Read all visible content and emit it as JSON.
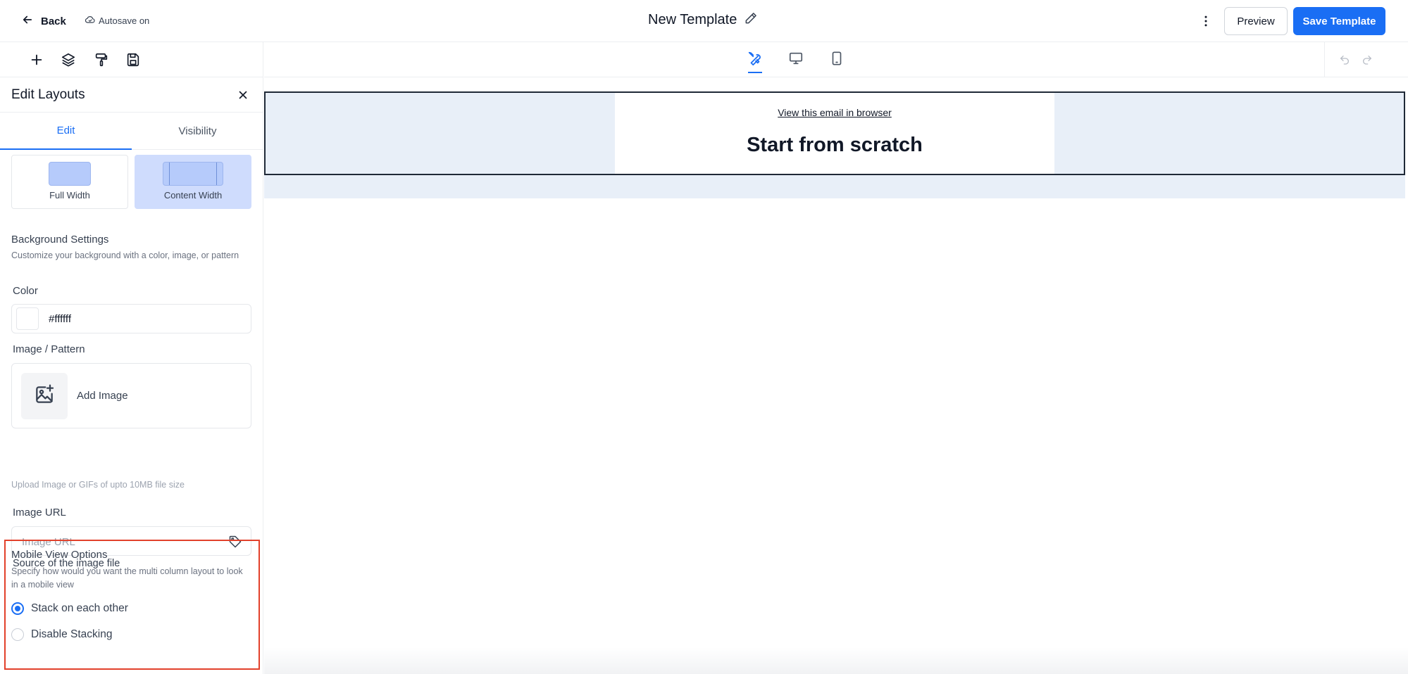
{
  "header": {
    "back_label": "Back",
    "autosave_label": "Autosave on",
    "title": "New Template",
    "preview_label": "Preview",
    "save_label": "Save Template"
  },
  "sidebar": {
    "panel_title": "Edit Layouts",
    "tabs": [
      {
        "label": "Edit",
        "active": true
      },
      {
        "label": "Visibility",
        "active": false
      }
    ],
    "width_options": [
      {
        "label": "Full Width",
        "selected": false
      },
      {
        "label": "Content Width",
        "selected": true
      }
    ],
    "background": {
      "title": "Background Settings",
      "description": "Customize your background with a color, image, or pattern",
      "color_label": "Color",
      "color_value": "#ffffff",
      "image_pattern_label": "Image / Pattern",
      "add_image_label": "Add Image",
      "upload_hint": "Upload Image or GIFs of upto 10MB file size",
      "image_url_label": "Image URL",
      "image_url_placeholder": "Image URL",
      "image_url_value": "",
      "image_url_help": "Source of the image file"
    },
    "mobile": {
      "title": "Mobile View Options",
      "description": "Specify how would you want the multi column layout to look in a mobile view",
      "options": [
        {
          "label": "Stack on each other",
          "checked": true
        },
        {
          "label": "Disable Stacking",
          "checked": false
        }
      ]
    }
  },
  "canvas": {
    "active_view": "editor",
    "email": {
      "view_in_browser": "View this email in browser",
      "heading": "Start from scratch"
    }
  },
  "colors": {
    "primary": "#1a6ef4",
    "highlight_border": "#e2412b",
    "email_background": "#e8eff8"
  },
  "icons": {
    "back": "arrow-left-icon",
    "autosave": "cloud-check-icon",
    "title_edit": "pencil-icon",
    "more": "kebab-icon",
    "tools": [
      "plus-icon",
      "layers-icon",
      "paint-roller-icon",
      "save-icon"
    ],
    "views": [
      "tools-icon",
      "desktop-icon",
      "mobile-icon"
    ]
  }
}
